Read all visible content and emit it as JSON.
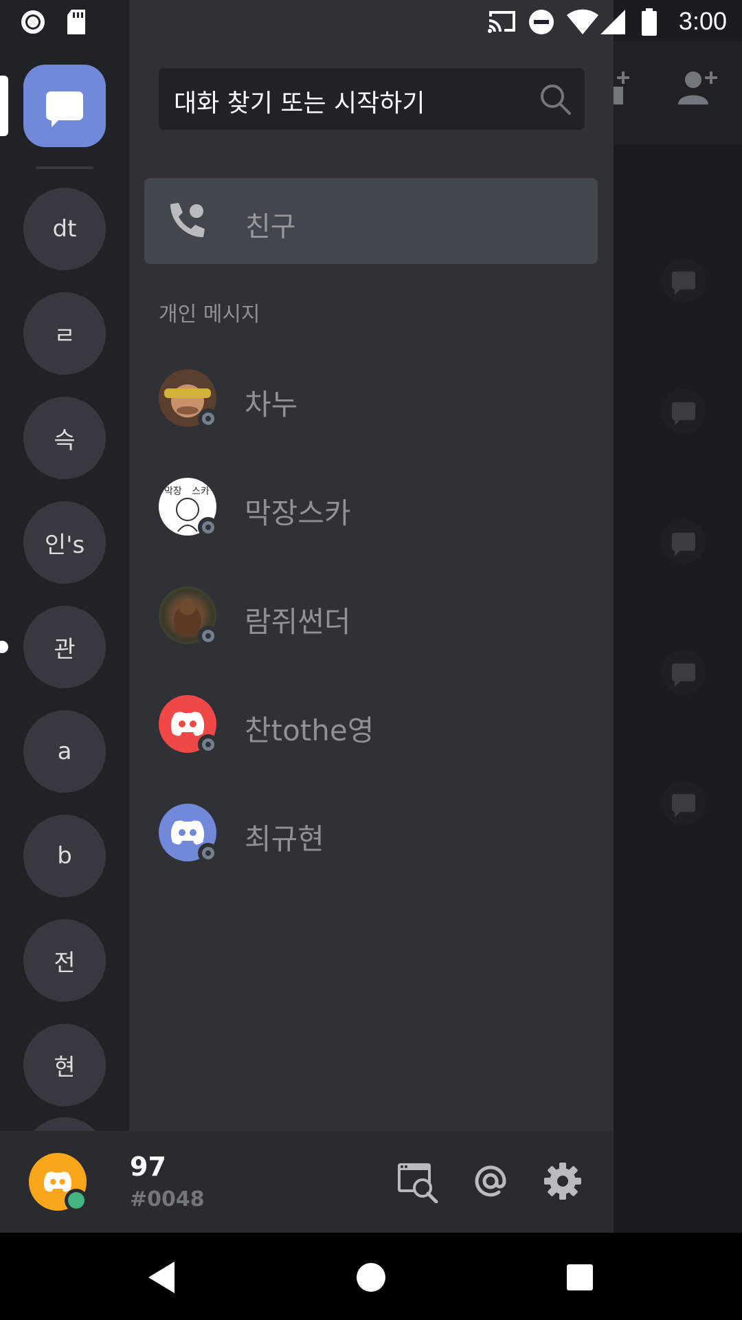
{
  "status_bar": {
    "time": "3:00",
    "icons": [
      "record-icon",
      "sd-card-icon",
      "cast-icon",
      "do-not-disturb-icon",
      "wifi-icon",
      "signal-icon",
      "battery-icon"
    ]
  },
  "servers": [
    {
      "label": "dt"
    },
    {
      "label": "ㄹ"
    },
    {
      "label": "슥"
    },
    {
      "label": "인's"
    },
    {
      "label": "관"
    },
    {
      "label": "a"
    },
    {
      "label": "b"
    },
    {
      "label": "전"
    },
    {
      "label": "현"
    }
  ],
  "search": {
    "placeholder": "대화 찾기 또는 시작하기"
  },
  "friends": {
    "label": "친구"
  },
  "dm_section": {
    "title": "개인 메시지"
  },
  "dms": [
    {
      "name": "차누",
      "avatar": "photo"
    },
    {
      "name": "막장스카",
      "avatar": "drawing"
    },
    {
      "name": "람쥐썬더",
      "avatar": "squirrel"
    },
    {
      "name": "찬tothe영",
      "avatar": "discord-red"
    },
    {
      "name": "최규현",
      "avatar": "discord-blurple"
    }
  ],
  "user": {
    "name": "97",
    "discriminator": "#0048"
  },
  "colors": {
    "accent": "#7289da",
    "online": "#43b581",
    "offline": "#747f8d",
    "user_avatar": "#faa61a",
    "red_avatar": "#f04747"
  }
}
